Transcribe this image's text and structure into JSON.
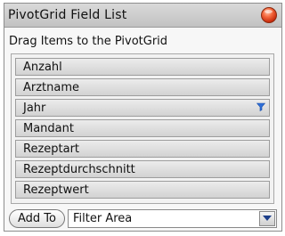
{
  "window": {
    "title": "PivotGrid Field List",
    "close_icon": "close-icon",
    "close_color": "#e5522b"
  },
  "hint": "Drag Items to the PivotGrid",
  "fields": [
    {
      "label": "Anzahl",
      "filtered": false
    },
    {
      "label": "Arztname",
      "filtered": false
    },
    {
      "label": "Jahr",
      "filtered": true
    },
    {
      "label": "Mandant",
      "filtered": false
    },
    {
      "label": "Rezeptart",
      "filtered": false
    },
    {
      "label": "Rezeptdurchschnitt",
      "filtered": false
    },
    {
      "label": "Rezeptwert",
      "filtered": false
    }
  ],
  "filter_icon": {
    "name": "filter-funnel-icon",
    "color": "#2f6fd8"
  },
  "footer": {
    "add_to_label": "Add To",
    "area_select_value": "Filter Area",
    "dropdown_icon": "chevron-down-icon"
  }
}
